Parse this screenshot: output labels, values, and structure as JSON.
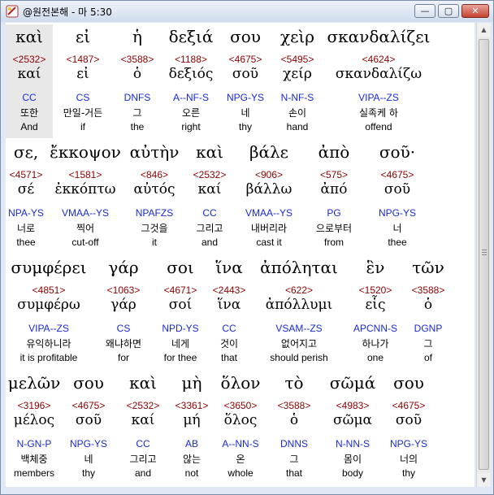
{
  "window": {
    "title": "@원전본해 - 마 5:30",
    "minimize_label": "—",
    "maximize_label": "▢",
    "close_label": "✕",
    "app_icon": "bible-app-icon"
  },
  "rows": [
    {
      "words": [
        {
          "greek": "καὶ",
          "strongs": "<2532>",
          "lemma": "καί",
          "parsing": "CC",
          "korean": "또한",
          "english": "And",
          "highlighted": true
        },
        {
          "greek": "εἰ",
          "strongs": "<1487>",
          "lemma": "εἰ",
          "parsing": "CS",
          "korean": "만일-거든",
          "english": "if"
        },
        {
          "greek": "ἡ",
          "strongs": "<3588>",
          "lemma": "ὁ",
          "parsing": "DNFS",
          "korean": "그",
          "english": "the"
        },
        {
          "greek": "δεξιά",
          "strongs": "<1188>",
          "lemma": "δεξιός",
          "parsing": "A--NF-S",
          "korean": "오른",
          "english": "right"
        },
        {
          "greek": "σου",
          "strongs": "<4675>",
          "lemma": "σοῦ",
          "parsing": "NPG-YS",
          "korean": "네",
          "english": "thy"
        },
        {
          "greek": "χεὶρ",
          "strongs": "<5495>",
          "lemma": "χείρ",
          "parsing": "N-NF-S",
          "korean": "손이",
          "english": "hand"
        },
        {
          "greek": "σκανδαλίζει",
          "strongs": "<4624>",
          "lemma": "σκανδαλίζω",
          "parsing": "VIPA--ZS",
          "korean": "실족케 하",
          "english": "offend"
        }
      ]
    },
    {
      "words": [
        {
          "greek": "σε,",
          "strongs": "<4571>",
          "lemma": "σέ",
          "parsing": "NPA-YS",
          "korean": "너로",
          "english": "thee"
        },
        {
          "greek": "ἔκκοψον",
          "strongs": "<1581>",
          "lemma": "ἐκκόπτω",
          "parsing": "VMAA--YS",
          "korean": "찍어",
          "english": "cut-off"
        },
        {
          "greek": "αὐτὴν",
          "strongs": "<846>",
          "lemma": "αὐτός",
          "parsing": "NPAFZS",
          "korean": "그것을",
          "english": "it"
        },
        {
          "greek": "καὶ",
          "strongs": "<2532>",
          "lemma": "καί",
          "parsing": "CC",
          "korean": "그리고",
          "english": "and"
        },
        {
          "greek": "βάλε",
          "strongs": "<906>",
          "lemma": "βάλλω",
          "parsing": "VMAA--YS",
          "korean": "내버리라",
          "english": "cast it"
        },
        {
          "greek": "ἀπὸ",
          "strongs": "<575>",
          "lemma": "ἀπό",
          "parsing": "PG",
          "korean": "으로부터",
          "english": "from"
        },
        {
          "greek": "σοῦ·",
          "strongs": "<4675>",
          "lemma": "σοῦ",
          "parsing": "NPG-YS",
          "korean": "너",
          "english": "thee"
        }
      ]
    },
    {
      "words": [
        {
          "greek": "συμφέρει",
          "strongs": "<4851>",
          "lemma": "συμφέρω",
          "parsing": "VIPA--ZS",
          "korean": "유익하니라",
          "english": "it is profitable"
        },
        {
          "greek": "γάρ",
          "strongs": "<1063>",
          "lemma": "γάρ",
          "parsing": "CS",
          "korean": "왜냐하면",
          "english": "for"
        },
        {
          "greek": "σοι",
          "strongs": "<4671>",
          "lemma": "σοί",
          "parsing": "NPD-YS",
          "korean": "네게",
          "english": "for thee"
        },
        {
          "greek": "ἵνα",
          "strongs": "<2443>",
          "lemma": "ἵνα",
          "parsing": "CC",
          "korean": "것이",
          "english": "that"
        },
        {
          "greek": "ἀπόληται",
          "strongs": "<622>",
          "lemma": "ἀπόλλυμι",
          "parsing": "VSAM--ZS",
          "korean": "없어지고",
          "english": "should perish"
        },
        {
          "greek": "ἓν",
          "strongs": "<1520>",
          "lemma": "εἷς",
          "parsing": "APCNN-S",
          "korean": "하나가",
          "english": "one"
        },
        {
          "greek": "τῶν",
          "strongs": "<3588>",
          "lemma": "ὁ",
          "parsing": "DGNP",
          "korean": "그",
          "english": "of"
        }
      ]
    },
    {
      "words": [
        {
          "greek": "μελῶν",
          "strongs": "<3196>",
          "lemma": "μέλος",
          "parsing": "N-GN-P",
          "korean": "백체중",
          "english": "members"
        },
        {
          "greek": "σου",
          "strongs": "<4675>",
          "lemma": "σοῦ",
          "parsing": "NPG-YS",
          "korean": "네",
          "english": "thy"
        },
        {
          "greek": "καὶ",
          "strongs": "<2532>",
          "lemma": "καί",
          "parsing": "CC",
          "korean": "그리고",
          "english": "and"
        },
        {
          "greek": "μὴ",
          "strongs": "<3361>",
          "lemma": "μή",
          "parsing": "AB",
          "korean": "않는",
          "english": "not"
        },
        {
          "greek": "ὅλον",
          "strongs": "<3650>",
          "lemma": "ὅλος",
          "parsing": "A--NN-S",
          "korean": "온",
          "english": "whole"
        },
        {
          "greek": "τὸ",
          "strongs": "<3588>",
          "lemma": "ὁ",
          "parsing": "DNNS",
          "korean": "그",
          "english": "that"
        },
        {
          "greek": "σῶμά",
          "strongs": "<4983>",
          "lemma": "σῶμα",
          "parsing": "N-NN-S",
          "korean": "몸이",
          "english": "body"
        },
        {
          "greek": "σου",
          "strongs": "<4675>",
          "lemma": "σοῦ",
          "parsing": "NPG-YS",
          "korean": "너의",
          "english": "thy"
        }
      ]
    }
  ],
  "colors": {
    "strongs": "#8b0000",
    "parsing": "#1a2ad0",
    "highlight": "#e8e8e8"
  }
}
